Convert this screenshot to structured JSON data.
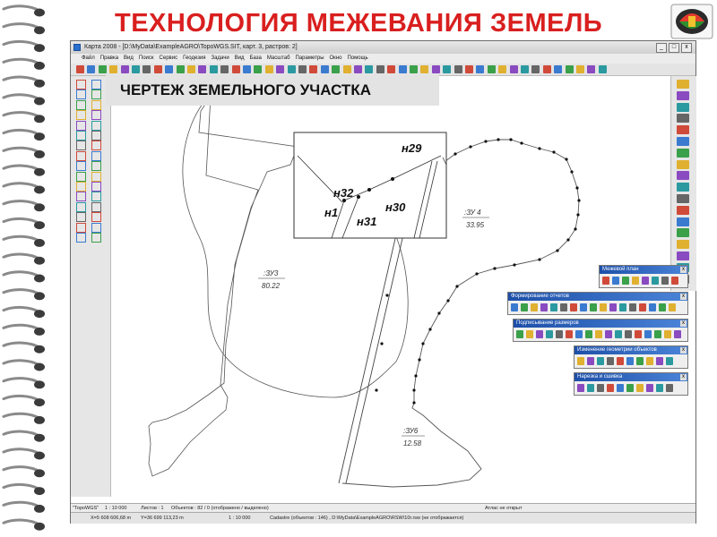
{
  "slide": {
    "title": "ТЕХНОЛОГИЯ МЕЖЕВАНИЯ ЗЕМЕЛЬ",
    "drawing_label": "ЧЕРТЕЖ ЗЕМЕЛЬНОГО УЧАСТКА"
  },
  "window": {
    "title": "Карта 2008 - [D:\\MyData\\ExampleAGRO\\TopoWGS.SIT, карт. 3, растров: 2]",
    "controls": [
      "_",
      "□",
      "x"
    ]
  },
  "menu": [
    "Файл",
    "Правка",
    "Вид",
    "Поиск",
    "Сервис",
    "Геодезия",
    "Задачи",
    "Вид",
    "База",
    "Масштаб",
    "Параметры",
    "Окно",
    "Помощь"
  ],
  "status1": {
    "name": "\"ТороWGS\"",
    "scale": "1 : 10 000",
    "sheets": "Листов : 1",
    "objects": "Объектов : 82 / 0 (отображено / выделено)",
    "atlas": "Атлас не открыт"
  },
  "status2": {
    "x": "X=5 608 606,68 m",
    "y": "Y=36 699 113,23 m",
    "scale": "1 : 10 000",
    "cadastre": "Cadastre  (объектов : 146) , D:\\MyData\\ExampleAGRO\\RSW\\10r.rsw (не отображается)"
  },
  "parcels": [
    {
      "id": "parcel-zu3",
      "name": ":ЗУ3",
      "area": "80.22"
    },
    {
      "id": "parcel-zu4",
      "name": ":ЗУ 4",
      "area": "33.95"
    },
    {
      "id": "parcel-zu6",
      "name": ":ЗУ6",
      "area": "12.58"
    }
  ],
  "inset_labels": [
    "н29",
    "н32",
    "н1",
    "н30",
    "н31"
  ],
  "palettes": [
    {
      "title": "Межевой план"
    },
    {
      "title": "Формирование отчетов"
    },
    {
      "title": "Подписывание размеров"
    },
    {
      "title": "Изменение геометрии объектов"
    },
    {
      "title": "Нарезка и сшивка"
    }
  ]
}
